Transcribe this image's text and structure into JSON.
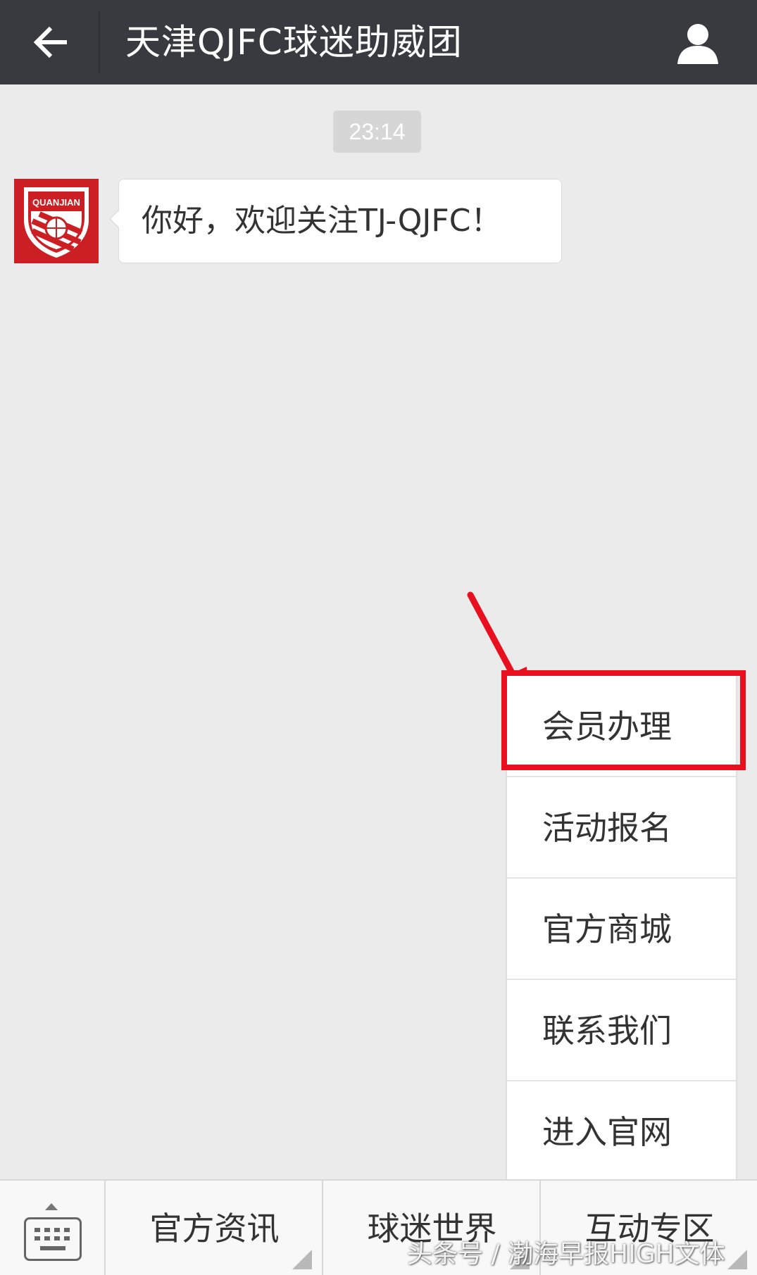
{
  "header": {
    "title": "天津QJFC球迷助威团",
    "back_icon": "back-arrow-icon",
    "profile_icon": "person-icon"
  },
  "chat": {
    "timestamp": "23:14",
    "message": "你好，欢迎关注TJ-QJFC！",
    "avatar_text": "QUANJIAN"
  },
  "menu": {
    "items": [
      {
        "label": "会员办理"
      },
      {
        "label": "活动报名"
      },
      {
        "label": "官方商城"
      },
      {
        "label": "联系我们"
      },
      {
        "label": "进入官网"
      }
    ]
  },
  "bottom": {
    "keyboard_icon": "keyboard-icon",
    "tabs": [
      {
        "label": "官方资讯"
      },
      {
        "label": "球迷世界"
      },
      {
        "label": "互动专区"
      }
    ]
  },
  "watermark": "头条号 / 渤海早报HIGH文体",
  "colors": {
    "topbar": "#393a3f",
    "background": "#ebebeb",
    "highlight": "#e8101e",
    "avatar": "#cc1f24"
  }
}
